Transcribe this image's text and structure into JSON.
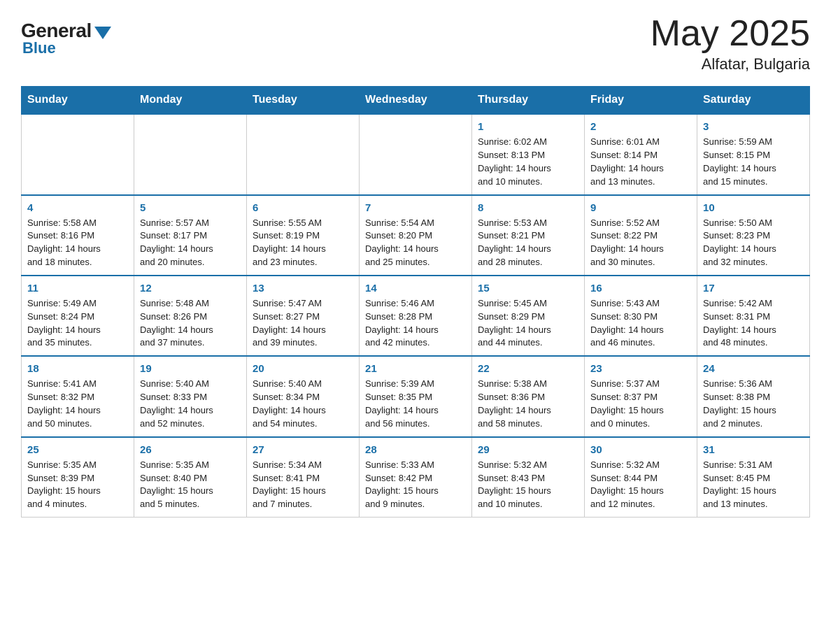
{
  "header": {
    "logo_general": "General",
    "logo_blue": "Blue",
    "month_year": "May 2025",
    "location": "Alfatar, Bulgaria"
  },
  "weekdays": [
    "Sunday",
    "Monday",
    "Tuesday",
    "Wednesday",
    "Thursday",
    "Friday",
    "Saturday"
  ],
  "weeks": [
    [
      {
        "day": "",
        "info": ""
      },
      {
        "day": "",
        "info": ""
      },
      {
        "day": "",
        "info": ""
      },
      {
        "day": "",
        "info": ""
      },
      {
        "day": "1",
        "info": "Sunrise: 6:02 AM\nSunset: 8:13 PM\nDaylight: 14 hours\nand 10 minutes."
      },
      {
        "day": "2",
        "info": "Sunrise: 6:01 AM\nSunset: 8:14 PM\nDaylight: 14 hours\nand 13 minutes."
      },
      {
        "day": "3",
        "info": "Sunrise: 5:59 AM\nSunset: 8:15 PM\nDaylight: 14 hours\nand 15 minutes."
      }
    ],
    [
      {
        "day": "4",
        "info": "Sunrise: 5:58 AM\nSunset: 8:16 PM\nDaylight: 14 hours\nand 18 minutes."
      },
      {
        "day": "5",
        "info": "Sunrise: 5:57 AM\nSunset: 8:17 PM\nDaylight: 14 hours\nand 20 minutes."
      },
      {
        "day": "6",
        "info": "Sunrise: 5:55 AM\nSunset: 8:19 PM\nDaylight: 14 hours\nand 23 minutes."
      },
      {
        "day": "7",
        "info": "Sunrise: 5:54 AM\nSunset: 8:20 PM\nDaylight: 14 hours\nand 25 minutes."
      },
      {
        "day": "8",
        "info": "Sunrise: 5:53 AM\nSunset: 8:21 PM\nDaylight: 14 hours\nand 28 minutes."
      },
      {
        "day": "9",
        "info": "Sunrise: 5:52 AM\nSunset: 8:22 PM\nDaylight: 14 hours\nand 30 minutes."
      },
      {
        "day": "10",
        "info": "Sunrise: 5:50 AM\nSunset: 8:23 PM\nDaylight: 14 hours\nand 32 minutes."
      }
    ],
    [
      {
        "day": "11",
        "info": "Sunrise: 5:49 AM\nSunset: 8:24 PM\nDaylight: 14 hours\nand 35 minutes."
      },
      {
        "day": "12",
        "info": "Sunrise: 5:48 AM\nSunset: 8:26 PM\nDaylight: 14 hours\nand 37 minutes."
      },
      {
        "day": "13",
        "info": "Sunrise: 5:47 AM\nSunset: 8:27 PM\nDaylight: 14 hours\nand 39 minutes."
      },
      {
        "day": "14",
        "info": "Sunrise: 5:46 AM\nSunset: 8:28 PM\nDaylight: 14 hours\nand 42 minutes."
      },
      {
        "day": "15",
        "info": "Sunrise: 5:45 AM\nSunset: 8:29 PM\nDaylight: 14 hours\nand 44 minutes."
      },
      {
        "day": "16",
        "info": "Sunrise: 5:43 AM\nSunset: 8:30 PM\nDaylight: 14 hours\nand 46 minutes."
      },
      {
        "day": "17",
        "info": "Sunrise: 5:42 AM\nSunset: 8:31 PM\nDaylight: 14 hours\nand 48 minutes."
      }
    ],
    [
      {
        "day": "18",
        "info": "Sunrise: 5:41 AM\nSunset: 8:32 PM\nDaylight: 14 hours\nand 50 minutes."
      },
      {
        "day": "19",
        "info": "Sunrise: 5:40 AM\nSunset: 8:33 PM\nDaylight: 14 hours\nand 52 minutes."
      },
      {
        "day": "20",
        "info": "Sunrise: 5:40 AM\nSunset: 8:34 PM\nDaylight: 14 hours\nand 54 minutes."
      },
      {
        "day": "21",
        "info": "Sunrise: 5:39 AM\nSunset: 8:35 PM\nDaylight: 14 hours\nand 56 minutes."
      },
      {
        "day": "22",
        "info": "Sunrise: 5:38 AM\nSunset: 8:36 PM\nDaylight: 14 hours\nand 58 minutes."
      },
      {
        "day": "23",
        "info": "Sunrise: 5:37 AM\nSunset: 8:37 PM\nDaylight: 15 hours\nand 0 minutes."
      },
      {
        "day": "24",
        "info": "Sunrise: 5:36 AM\nSunset: 8:38 PM\nDaylight: 15 hours\nand 2 minutes."
      }
    ],
    [
      {
        "day": "25",
        "info": "Sunrise: 5:35 AM\nSunset: 8:39 PM\nDaylight: 15 hours\nand 4 minutes."
      },
      {
        "day": "26",
        "info": "Sunrise: 5:35 AM\nSunset: 8:40 PM\nDaylight: 15 hours\nand 5 minutes."
      },
      {
        "day": "27",
        "info": "Sunrise: 5:34 AM\nSunset: 8:41 PM\nDaylight: 15 hours\nand 7 minutes."
      },
      {
        "day": "28",
        "info": "Sunrise: 5:33 AM\nSunset: 8:42 PM\nDaylight: 15 hours\nand 9 minutes."
      },
      {
        "day": "29",
        "info": "Sunrise: 5:32 AM\nSunset: 8:43 PM\nDaylight: 15 hours\nand 10 minutes."
      },
      {
        "day": "30",
        "info": "Sunrise: 5:32 AM\nSunset: 8:44 PM\nDaylight: 15 hours\nand 12 minutes."
      },
      {
        "day": "31",
        "info": "Sunrise: 5:31 AM\nSunset: 8:45 PM\nDaylight: 15 hours\nand 13 minutes."
      }
    ]
  ]
}
